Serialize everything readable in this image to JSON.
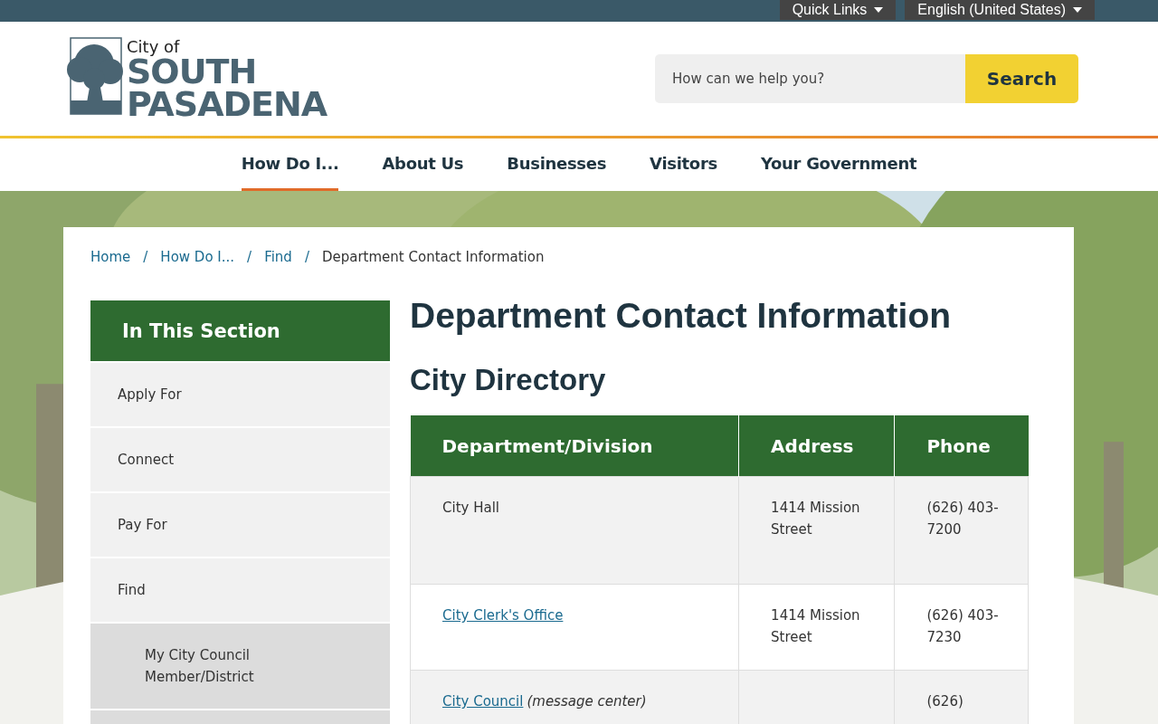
{
  "top_bar": {
    "menus": [
      {
        "label": "Quick Links"
      },
      {
        "label": "English (United States)"
      }
    ]
  },
  "logo": {
    "small": "City of",
    "line_1": "SOUTH",
    "line_2": "PASADENA"
  },
  "search": {
    "placeholder": "How can we help you?",
    "button": "Search"
  },
  "nav": [
    {
      "label": "How Do I...",
      "selected": true
    },
    {
      "label": "About Us",
      "selected": false
    },
    {
      "label": "Businesses",
      "selected": false
    },
    {
      "label": "Visitors",
      "selected": false
    },
    {
      "label": "Your Government",
      "selected": false
    }
  ],
  "breadcrumbs": [
    {
      "label": "Home",
      "link": true
    },
    {
      "separator": "/",
      "label": "How Do I...",
      "link": true
    },
    {
      "separator": "/",
      "label": "Find",
      "link": true
    },
    {
      "separator": "/",
      "label": "Department Contact Information",
      "link": false
    }
  ],
  "sidebar": {
    "title": "In This Section",
    "items": [
      {
        "label": "Apply For"
      },
      {
        "label": "Connect"
      },
      {
        "label": "Pay For"
      },
      {
        "label": "Find",
        "children": [
          {
            "kind": "link",
            "label": "My City Council Member/District"
          },
          {
            "kind": "blank"
          }
        ]
      }
    ]
  },
  "page_title": "Department Contact Information",
  "section_title": "City Directory",
  "table": {
    "columns": [
      "Department/Division",
      "Address",
      "Phone"
    ],
    "rows": [
      {
        "department": "City Hall",
        "link": false,
        "address": "1414 Mission Street",
        "phone": "(626) 403-7200"
      },
      {
        "department": "City Clerk's Office",
        "link": true,
        "address": "1414 Mission Street",
        "phone": "(626) 403-7230"
      },
      {
        "department": "City Council",
        "link": true,
        "note": "(message center)",
        "phone": "(626)"
      }
    ]
  }
}
